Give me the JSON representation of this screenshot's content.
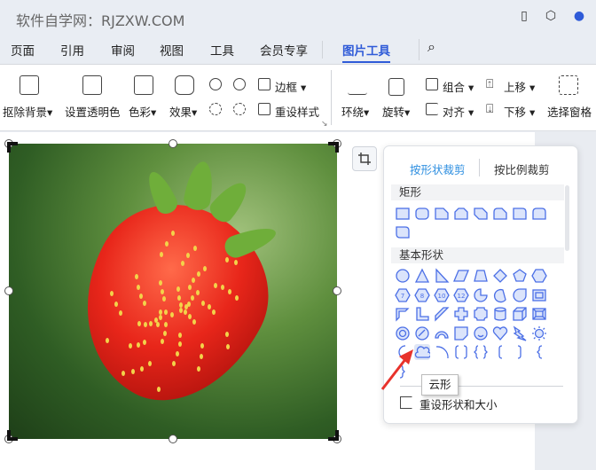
{
  "title": "软件自学网：RJZXW.COM",
  "tabs": [
    "页面",
    "引用",
    "审阅",
    "视图",
    "工具",
    "会员专享",
    "图片工具"
  ],
  "active_tab": "图片工具",
  "ribbon": {
    "remove_bg": "抠除背景",
    "set_transparent": "设置透明色",
    "color": "色彩",
    "effects": "效果",
    "border": "边框",
    "reset_style": "重设样式",
    "wrap": "环绕",
    "rotate": "旋转",
    "group": "组合",
    "align": "对齐",
    "bring_forward": "上移",
    "send_backward": "下移",
    "selection_pane": "选择窗格"
  },
  "crop_panel": {
    "tab_shape": "按形状裁剪",
    "tab_ratio": "按比例裁剪",
    "section_rect": "矩形",
    "section_basic": "基本形状",
    "reset": "重设形状和大小",
    "tooltip": "云形",
    "rect_shapes": [
      "rect",
      "round-rect",
      "snip1",
      "snip2-same",
      "snip2-diag",
      "round-snip",
      "round1",
      "round2-same",
      "round2-diag"
    ],
    "basic_shapes": [
      "oval",
      "triangle",
      "right-triangle",
      "parallelogram",
      "trapezoid",
      "diamond",
      "pentagon",
      "hexagon",
      "heptagon",
      "octagon",
      "decagon",
      "dodecagon",
      "pie",
      "chord",
      "teardrop",
      "frame",
      "half-frame",
      "l-shape",
      "diagonal-stripe",
      "cross",
      "plaque",
      "can",
      "cube",
      "bevel",
      "donut",
      "no-symbol",
      "block-arc",
      "folded-corner",
      "smiley",
      "heart",
      "lightning",
      "sun",
      "moon",
      "cloud",
      "arc",
      "double-bracket",
      "double-brace",
      "left-bracket",
      "right-bracket",
      "left-brace",
      "right-brace"
    ],
    "basic_labels": {
      "heptagon": "7",
      "octagon": "8",
      "decagon": "10",
      "dodecagon": "12"
    },
    "hovered_shape": "cloud"
  },
  "colors": {
    "accent": "#2f5bd8",
    "shape_fill": "#dbe4fb",
    "shape_stroke": "#4b6fe6",
    "arrow": "#e8322b"
  }
}
